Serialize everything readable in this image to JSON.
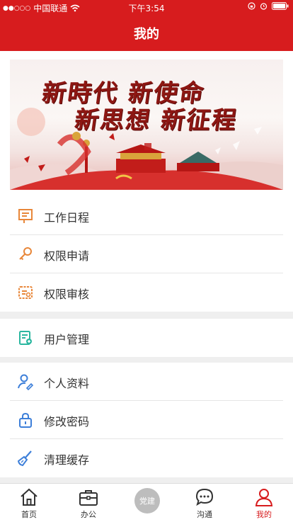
{
  "status_bar": {
    "carrier": "中国联通",
    "time": "下午3:54"
  },
  "header": {
    "title": "我的"
  },
  "banner": {
    "line1": "新時代 新使命",
    "line2": "新思想 新征程"
  },
  "menu_groups": [
    {
      "items": [
        {
          "label": "工作日程",
          "icon": "schedule-icon"
        },
        {
          "label": "权限申请",
          "icon": "key-icon"
        },
        {
          "label": "权限审核",
          "icon": "audit-icon"
        }
      ]
    },
    {
      "items": [
        {
          "label": "用户管理",
          "icon": "user-manage-icon"
        }
      ]
    },
    {
      "items": [
        {
          "label": "个人资料",
          "icon": "profile-icon"
        },
        {
          "label": "修改密码",
          "icon": "lock-icon"
        },
        {
          "label": "清理缓存",
          "icon": "brush-icon"
        }
      ]
    }
  ],
  "tab_bar": {
    "tabs": [
      {
        "label": "首页",
        "icon": "home-icon"
      },
      {
        "label": "办公",
        "icon": "briefcase-icon"
      },
      {
        "label": "党建",
        "icon": "party-badge-icon"
      },
      {
        "label": "沟通",
        "icon": "chat-icon"
      },
      {
        "label": "我的",
        "icon": "person-icon"
      }
    ],
    "active": "我的"
  },
  "colors": {
    "brand_red": "#d71c1e",
    "icon_orange": "#e8873a",
    "icon_teal": "#2bb7a0",
    "icon_blue": "#3d7fd9"
  }
}
